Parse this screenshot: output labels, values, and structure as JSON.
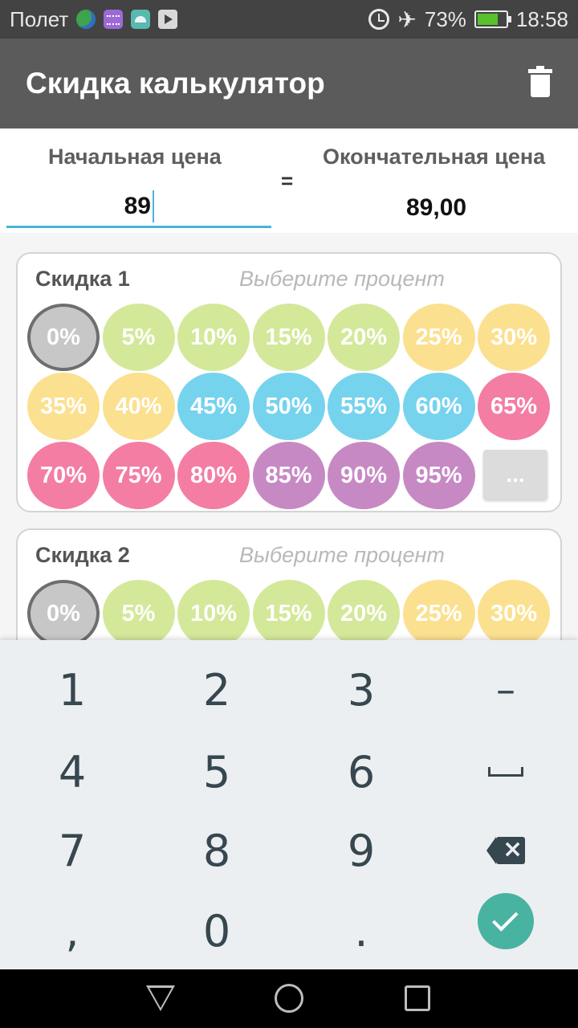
{
  "status_bar": {
    "carrier": "Полет",
    "battery": "73%",
    "time": "18:58",
    "icons": [
      "globe-icon",
      "keyboard-icon",
      "android-icon",
      "play-store-icon",
      "alarm-icon",
      "airplane-icon",
      "battery-charging-icon"
    ]
  },
  "app_bar": {
    "title": "Скидка калькулятор",
    "action_icon": "trash-icon"
  },
  "price": {
    "start_label": "Начальная цена",
    "start_value": "89",
    "equals": "=",
    "final_label": "Окончательная цена",
    "final_value": "89,00"
  },
  "discounts": [
    {
      "title": "Скидка 1",
      "hint": "Выберите процент",
      "selected": "0%",
      "options": [
        "0%",
        "5%",
        "10%",
        "15%",
        "20%",
        "25%",
        "30%",
        "35%",
        "40%",
        "45%",
        "50%",
        "55%",
        "60%",
        "65%",
        "70%",
        "75%",
        "80%",
        "85%",
        "90%",
        "95%"
      ],
      "more_label": "..."
    },
    {
      "title": "Скидка 2",
      "hint": "Выберите процент",
      "selected": "0%",
      "options": [
        "0%",
        "5%",
        "10%",
        "15%",
        "20%",
        "25%",
        "30%"
      ]
    }
  ],
  "colors": {
    "selected": "#c7c7c7",
    "green": "#d4e89a",
    "yellow": "#fbe08f",
    "blue": "#76d3ee",
    "pink": "#f47da4",
    "purple": "#c789c4",
    "accent_input": "#4bb3d6",
    "enter_key": "#49b3a1"
  },
  "keyboard": {
    "keys": [
      "1",
      "2",
      "3",
      "–",
      "4",
      "5",
      "6",
      "",
      "7",
      "8",
      "9",
      "",
      ",",
      "0",
      ".",
      ""
    ],
    "icons": [
      "space-icon",
      "backspace-icon",
      "check-icon"
    ]
  },
  "nav_bar": {
    "icons": [
      "back-icon",
      "home-icon",
      "recents-icon"
    ]
  }
}
